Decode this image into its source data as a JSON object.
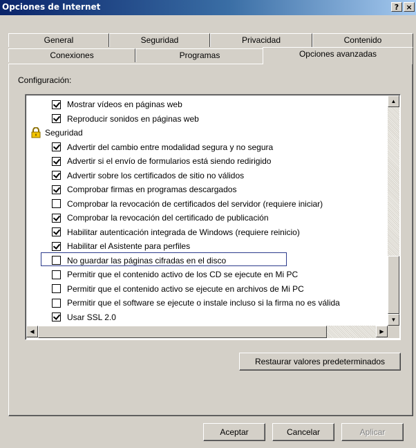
{
  "window": {
    "title": "Opciones de Internet",
    "help_button": "?",
    "close_button": "×"
  },
  "tabs": {
    "row1": [
      "General",
      "Seguridad",
      "Privacidad",
      "Contenido"
    ],
    "row2": [
      "Conexiones",
      "Programas",
      "Opciones avanzadas"
    ],
    "selected": "Opciones avanzadas"
  },
  "config": {
    "label": "Configuración:"
  },
  "list": {
    "items": [
      {
        "text": "Mostrar vídeos en páginas web",
        "checked": true
      },
      {
        "text": "Reproducir sonidos en páginas web",
        "checked": true
      },
      {
        "text": "Seguridad",
        "category": true,
        "icon": "lock-icon"
      },
      {
        "text": "Advertir del cambio entre modalidad segura y no segura",
        "checked": true
      },
      {
        "text": "Advertir si el envío de formularios está siendo redirigido",
        "checked": true
      },
      {
        "text": "Advertir sobre los certificados de sitio no válidos",
        "checked": true
      },
      {
        "text": "Comprobar firmas en programas descargados",
        "checked": true
      },
      {
        "text": "Comprobar la revocación de certificados del servidor (requiere iniciar)",
        "checked": false
      },
      {
        "text": "Comprobar la revocación del certificado de publicación",
        "checked": true
      },
      {
        "text": "Habilitar autenticación integrada de Windows (requiere reinicio)",
        "checked": true
      },
      {
        "text": "Habilitar el Asistente para perfiles",
        "checked": true
      },
      {
        "text": "No guardar las páginas cifradas en el disco",
        "checked": false,
        "focused": true
      },
      {
        "text": "Permitir que el contenido activo de los CD se ejecute en Mi PC",
        "checked": false
      },
      {
        "text": "Permitir que el contenido activo se ejecute en archivos de Mi PC",
        "checked": false
      },
      {
        "text": "Permitir que el software se ejecute o instale incluso si la firma no es válida",
        "checked": false
      },
      {
        "text": "Usar SSL 2.0",
        "checked": true
      }
    ]
  },
  "buttons": {
    "restore": "Restaurar valores predeterminados",
    "ok": "Aceptar",
    "cancel": "Cancelar",
    "apply": "Aplicar"
  }
}
